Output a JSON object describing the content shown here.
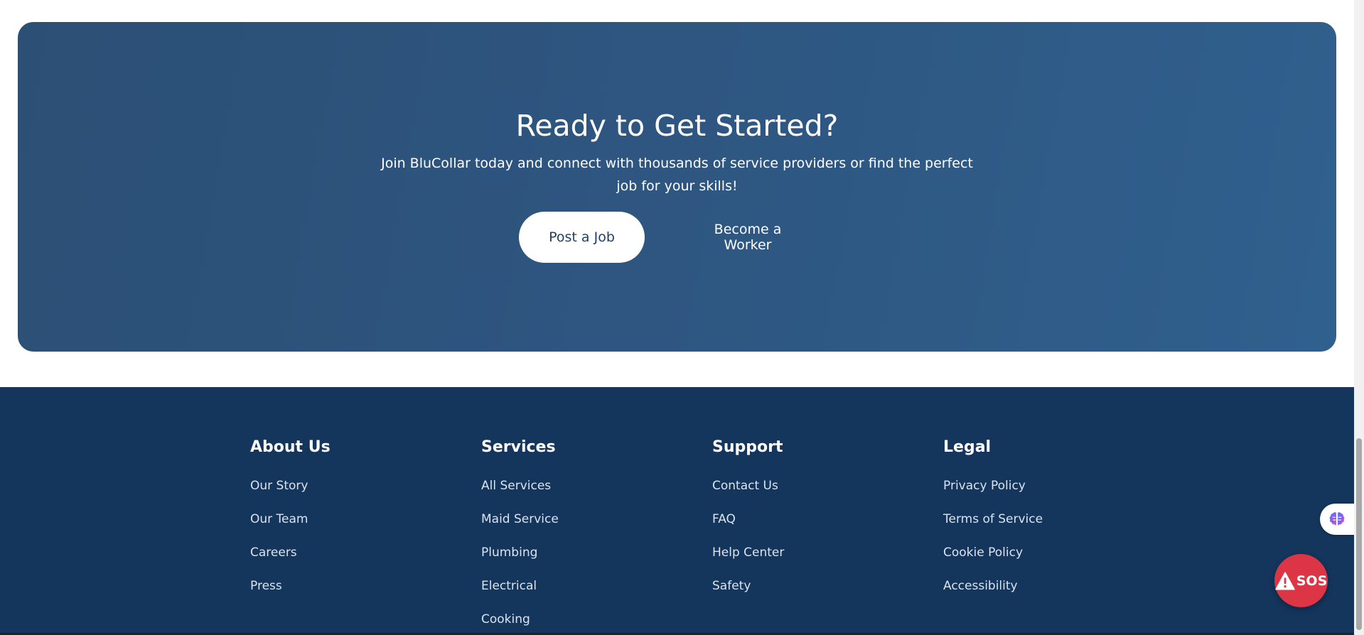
{
  "cta": {
    "title": "Ready to Get Started?",
    "subtitle": "Join BluCollar today and connect with thousands of service providers or find the perfect job for your skills!",
    "primary_button": "Post a Job",
    "secondary_button": "Become a Worker"
  },
  "footer": {
    "columns": [
      {
        "heading": "About Us",
        "links": [
          "Our Story",
          "Our Team",
          "Careers",
          "Press"
        ]
      },
      {
        "heading": "Services",
        "links": [
          "All Services",
          "Maid Service",
          "Plumbing",
          "Electrical",
          "Cooking"
        ]
      },
      {
        "heading": "Support",
        "links": [
          "Contact Us",
          "FAQ",
          "Help Center",
          "Safety"
        ]
      },
      {
        "heading": "Legal",
        "links": [
          "Privacy Policy",
          "Terms of Service",
          "Cookie Policy",
          "Accessibility"
        ]
      }
    ]
  },
  "widgets": {
    "ai_assistant_icon": "brain-icon",
    "sos_label": "SOS",
    "sos_icon": "warning-icon"
  },
  "colors": {
    "cta_background": "#2e5782",
    "footer_background": "#14355c",
    "sos_red": "#dc3545",
    "primary_text": "#1f3f66"
  }
}
